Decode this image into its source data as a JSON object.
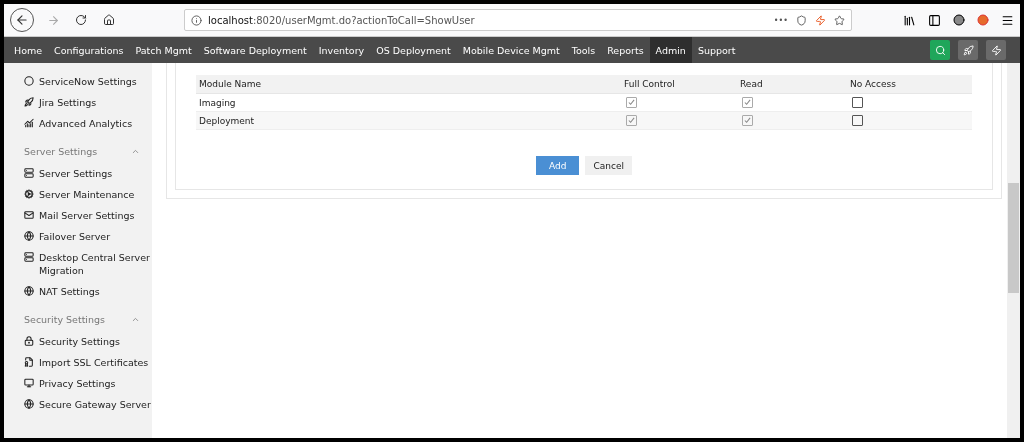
{
  "browser": {
    "url_host": "localhost",
    "url_rest": ":8020/userMgmt.do?actionToCall=ShowUser",
    "more": "•••"
  },
  "nav": [
    {
      "label": "Home",
      "selected": false
    },
    {
      "label": "Configurations",
      "selected": false
    },
    {
      "label": "Patch Mgmt",
      "selected": false
    },
    {
      "label": "Software Deployment",
      "selected": false
    },
    {
      "label": "Inventory",
      "selected": false
    },
    {
      "label": "OS Deployment",
      "selected": false
    },
    {
      "label": "Mobile Device Mgmt",
      "selected": false
    },
    {
      "label": "Tools",
      "selected": false
    },
    {
      "label": "Reports",
      "selected": false
    },
    {
      "label": "Admin",
      "selected": true
    },
    {
      "label": "Support",
      "selected": false
    }
  ],
  "sidebar": [
    {
      "kind": "item",
      "label": "ServiceNow Settings"
    },
    {
      "kind": "item",
      "label": "Jira Settings"
    },
    {
      "kind": "item",
      "label": "Advanced Analytics"
    },
    {
      "kind": "section",
      "label": "Server Settings",
      "expanded": true
    },
    {
      "kind": "item",
      "label": "Server Settings"
    },
    {
      "kind": "item",
      "label": "Server Maintenance"
    },
    {
      "kind": "item",
      "label": "Mail Server Settings"
    },
    {
      "kind": "item",
      "label": "Failover Server"
    },
    {
      "kind": "item",
      "label": "Desktop Central Server Migration"
    },
    {
      "kind": "item",
      "label": "NAT Settings"
    },
    {
      "kind": "section",
      "label": "Security Settings",
      "expanded": true
    },
    {
      "kind": "item",
      "label": "Security Settings"
    },
    {
      "kind": "item",
      "label": "Import SSL Certificates"
    },
    {
      "kind": "item",
      "label": "Privacy Settings"
    },
    {
      "kind": "item",
      "label": "Secure Gateway Server"
    }
  ],
  "table": {
    "columns": [
      "Module Name",
      "Full Control",
      "Read",
      "No Access"
    ],
    "rows": [
      {
        "module": "Imaging",
        "full_control": {
          "checked": true
        },
        "read": {
          "checked": true
        },
        "no_access": {
          "checked": false
        }
      },
      {
        "module": "Deployment",
        "full_control": {
          "checked": true
        },
        "read": {
          "checked": true
        },
        "no_access": {
          "checked": false
        }
      }
    ]
  },
  "buttons": [
    {
      "kind": "primary",
      "label": "Add"
    },
    {
      "kind": "secondary",
      "label": "Cancel"
    }
  ]
}
